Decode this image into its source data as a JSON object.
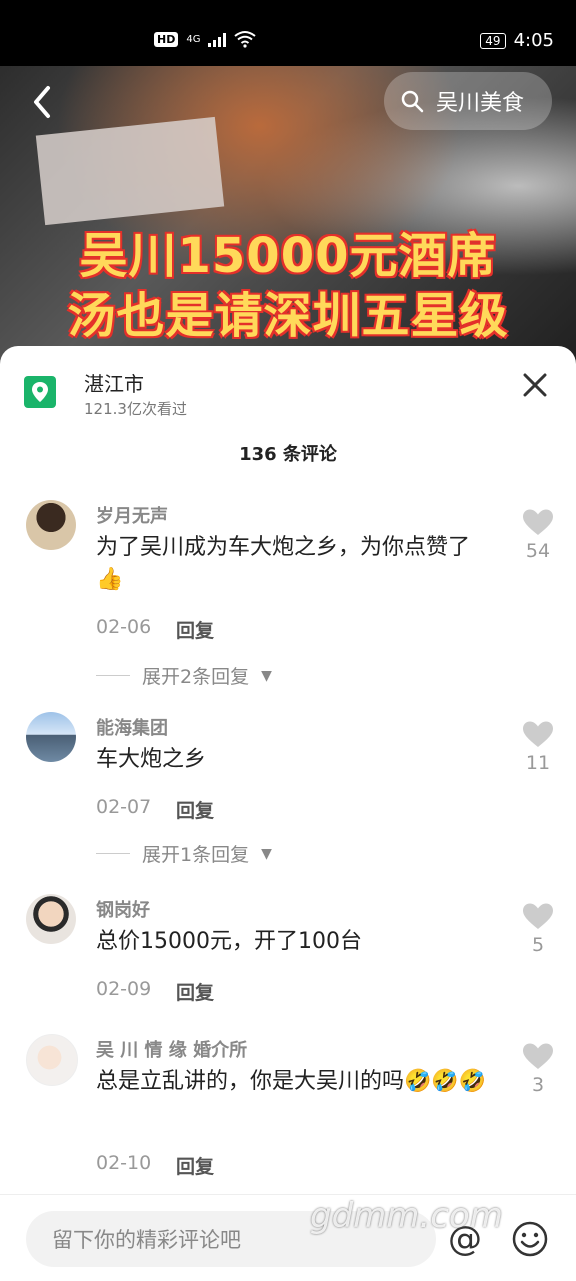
{
  "status": {
    "hd": "HD",
    "network": "4G",
    "battery": "49",
    "time": "4:05"
  },
  "video": {
    "search_label": "吴川美食",
    "overlay_line1": "吴川15000元酒席",
    "overlay_line2": "汤也是请深圳五星级"
  },
  "location": {
    "name": "湛江市",
    "views": "121.3亿次看过"
  },
  "comments_header": "136 条评论",
  "comments": [
    {
      "user": "岁月无声",
      "text": "为了吴川成为车大炮之乡，为你点赞了👍",
      "date": "02-06",
      "reply": "回复",
      "likes": "54",
      "expand": "展开2条回复"
    },
    {
      "user": "能海集团",
      "text": "车大炮之乡",
      "date": "02-07",
      "reply": "回复",
      "likes": "11",
      "expand": "展开1条回复"
    },
    {
      "user": "钢岗好",
      "text": "总价15000元，开了100台",
      "date": "02-09",
      "reply": "回复",
      "likes": "5"
    },
    {
      "user": "吴 川 情 缘 婚介所",
      "text": "总是立乱讲的，你是大吴川的吗🤣🤣🤣",
      "date": "02-10",
      "reply": "回复",
      "likes": "3"
    }
  ],
  "input_placeholder": "留下你的精彩评论吧",
  "at_symbol": "@",
  "watermark": "gdmm.com",
  "colors": {
    "location_icon": "#1ab46a",
    "overlay_text": "#ffd95a",
    "overlay_stroke": "#e4312b"
  }
}
